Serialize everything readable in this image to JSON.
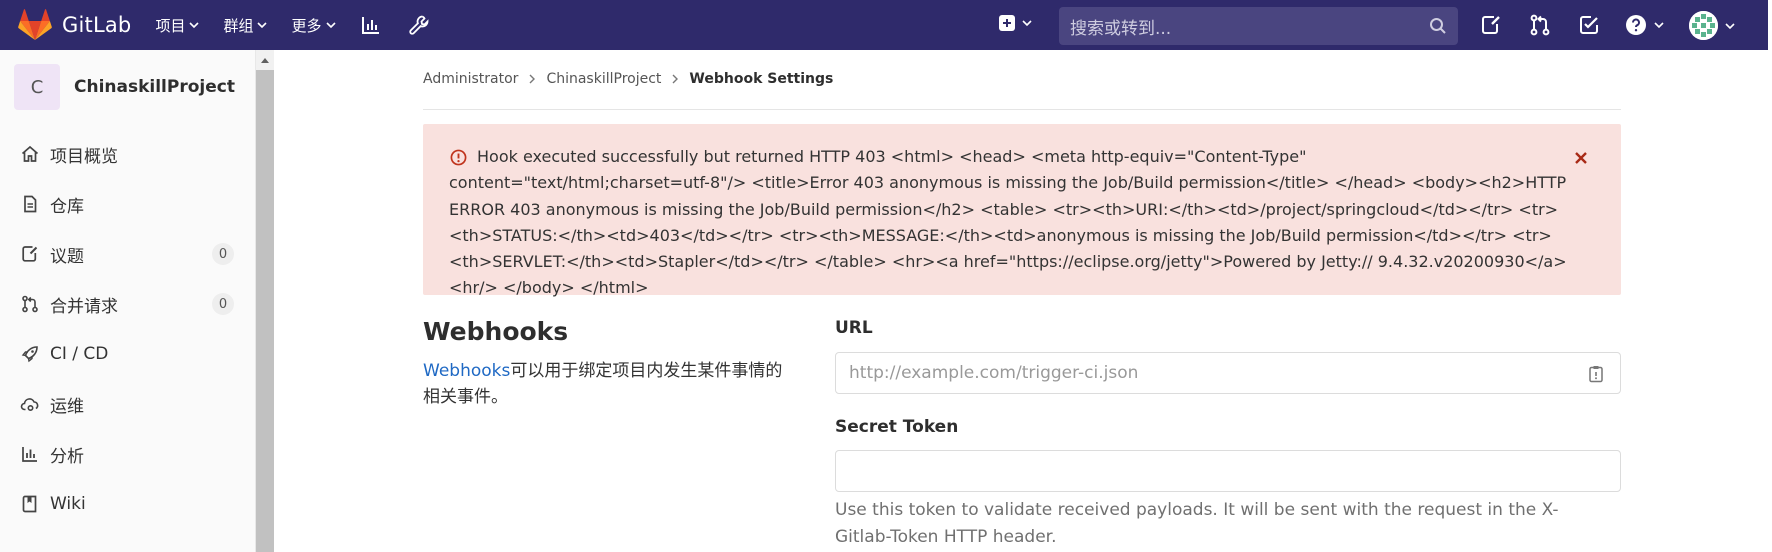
{
  "navbar": {
    "brand": "GitLab",
    "menu": [
      {
        "label": "项目"
      },
      {
        "label": "群组"
      },
      {
        "label": "更多"
      }
    ],
    "search_placeholder": "搜索或转到..."
  },
  "sidebar": {
    "project_initial": "C",
    "project_name": "ChinaskillProject",
    "items": [
      {
        "label": "项目概览",
        "icon": "home-icon"
      },
      {
        "label": "仓库",
        "icon": "file-icon"
      },
      {
        "label": "议题",
        "icon": "issues-icon",
        "count": "0"
      },
      {
        "label": "合并请求",
        "icon": "merge-request-icon",
        "count": "0"
      },
      {
        "label": "CI / CD",
        "icon": "rocket-icon"
      },
      {
        "label": "运维",
        "icon": "cloud-gear-icon"
      },
      {
        "label": "分析",
        "icon": "chart-icon"
      },
      {
        "label": "Wiki",
        "icon": "book-icon"
      }
    ]
  },
  "breadcrumb": {
    "items": [
      "Administrator",
      "ChinaskillProject",
      "Webhook Settings"
    ]
  },
  "alert": {
    "message": "Hook executed successfully but returned HTTP 403 <html> <head> <meta http-equiv=\"Content-Type\" content=\"text/html;charset=utf-8\"/> <title>Error 403 anonymous is missing the Job/Build permission</title> </head> <body><h2>HTTP ERROR 403 anonymous is missing the Job/Build permission</h2> <table> <tr><th>URI:</th><td>/project/springcloud</td></tr> <tr><th>STATUS:</th><td>403</td></tr> <tr><th>MESSAGE:</th><td>anonymous is missing the Job/Build permission</td></tr> <tr><th>SERVLET:</th><td>Stapler</td></tr> </table> <hr><a href=\"https://eclipse.org/jetty\">Powered by Jetty:// 9.4.32.v20200930</a><hr/> </body> </html>",
    "colors": {
      "background": "#f9e1de",
      "icon": "#c0341d"
    }
  },
  "webhooks": {
    "title": "Webhooks",
    "desc_link": "Webhooks",
    "desc_text": "可以用于绑定项目内发生某件事情的相关事件。",
    "url_label": "URL",
    "url_placeholder": "http://example.com/trigger-ci.json",
    "token_label": "Secret Token",
    "token_value": "",
    "token_help": "Use this token to validate received payloads. It will be sent with the request in the X-Gitlab-Token HTTP header."
  },
  "colors": {
    "navbar": "#2f2a6b",
    "link": "#1f69c4"
  }
}
